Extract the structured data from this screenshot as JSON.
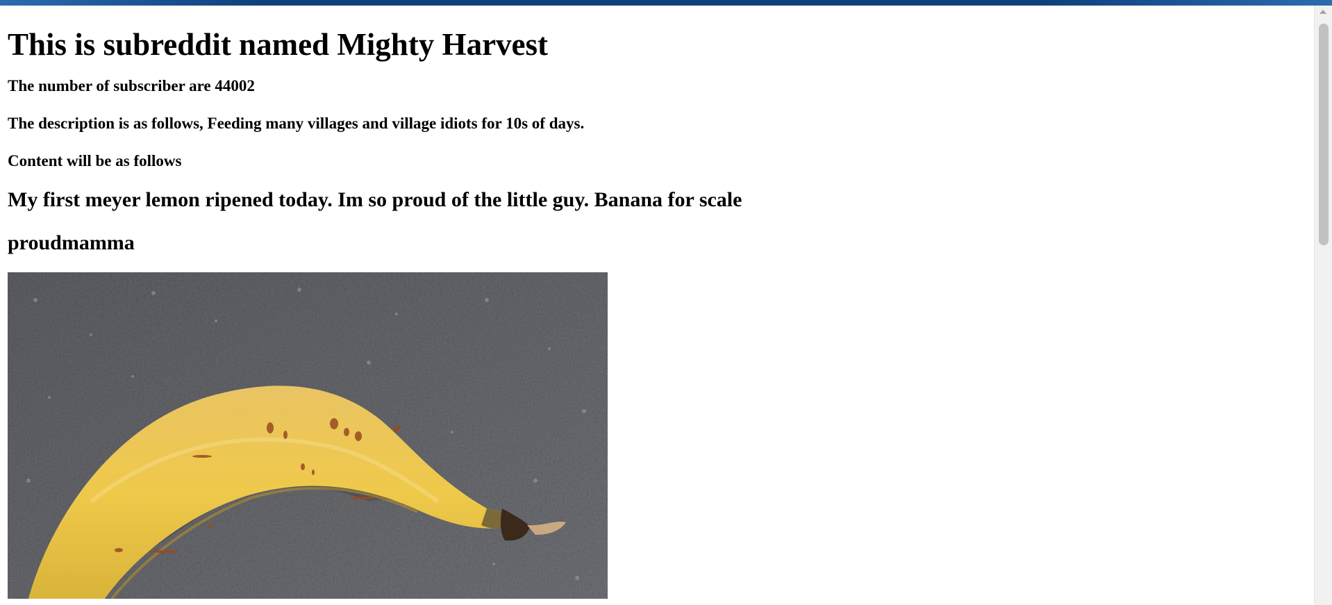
{
  "page": {
    "heading": "This is subreddit named Mighty Harvest",
    "subscribers": "The number of subscriber are 44002",
    "description": "The description is as follows, Feeding many villages and village idiots for 10s of days.",
    "content_label": "Content will be as follows"
  },
  "post": {
    "title": "My first meyer lemon ripened today. Im so proud of the little guy. Banana for scale",
    "author": "proudmamma",
    "image_icon": "banana-photo"
  },
  "colors": {
    "top_bar": "#0f3f7c",
    "background": "#ffffff",
    "text": "#000000",
    "countertop": "#6b6c70",
    "banana": "#eac34e"
  }
}
